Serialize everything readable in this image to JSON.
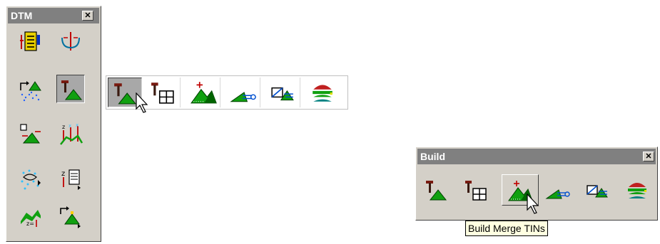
{
  "dtm_palette": {
    "title": "DTM",
    "close_glyph": "✕",
    "tools": [
      {
        "icon": "surface-report-icon"
      },
      {
        "icon": "contour-section-icon"
      },
      {
        "icon": "import-points-icon"
      },
      {
        "icon": "build-tin-icon",
        "state": "pressed"
      },
      {
        "icon": "triangle-edit-icon"
      },
      {
        "icon": "elevation-points-icon"
      },
      {
        "icon": "point-cloud-icon"
      },
      {
        "icon": "z-report-icon"
      },
      {
        "icon": "profile-z-icon"
      },
      {
        "icon": "export-surface-icon"
      }
    ]
  },
  "flyout": {
    "tools": [
      {
        "icon": "build-tin-icon"
      },
      {
        "icon": "build-grid-tin-icon"
      },
      {
        "icon": "build-merge-tins-icon"
      },
      {
        "icon": "build-extend-tin-icon"
      },
      {
        "icon": "build-clip-tin-icon"
      },
      {
        "icon": "build-layered-tin-icon"
      }
    ]
  },
  "build_palette": {
    "title": "Build",
    "close_glyph": "✕",
    "tools": [
      {
        "icon": "build-tin-icon"
      },
      {
        "icon": "build-grid-tin-icon"
      },
      {
        "icon": "build-merge-tins-icon",
        "state": "hover"
      },
      {
        "icon": "build-extend-tin-icon"
      },
      {
        "icon": "build-clip-tin-icon"
      },
      {
        "icon": "build-layered-tin-icon"
      }
    ],
    "tooltip": "Build Merge TINs"
  },
  "colors": {
    "palette_bg": "#d4d0c8",
    "titlebar_inactive": "#808080",
    "terrain_green": "#10a010",
    "dark_green": "#006400",
    "tooltip_bg": "#ffffe1"
  }
}
